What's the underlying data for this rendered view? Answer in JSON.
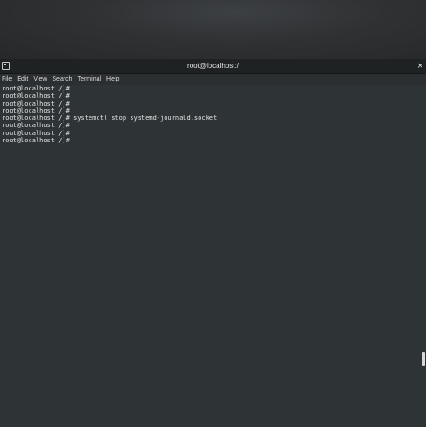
{
  "window": {
    "title": "root@localhost:/",
    "close_glyph": "×"
  },
  "menu": [
    "File",
    "Edit",
    "View",
    "Search",
    "Terminal",
    "Help"
  ],
  "terminal": {
    "lines": [
      "root@localhost /]#",
      "root@localhost /]#",
      "root@localhost /]#",
      "root@localhost /]#",
      "root@localhost /]# systemctl stop systemd-journald.socket",
      "root@localhost /]#",
      "root@localhost /]#",
      "root@localhost /]#"
    ]
  },
  "icons": {
    "window": "terminal-window-icon",
    "close": "close-icon"
  }
}
